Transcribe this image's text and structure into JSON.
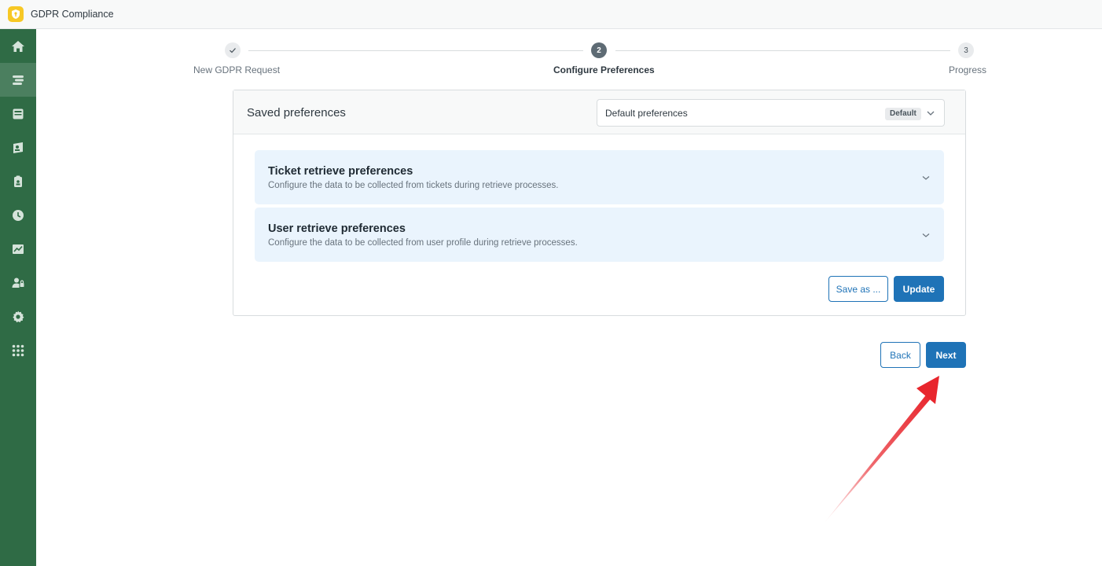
{
  "app": {
    "title": "GDPR Compliance",
    "logo_icon": "gdpr-shield-logo",
    "accent_color": "#1f73b7",
    "sidebar_color": "#2f6b45"
  },
  "sidebar": {
    "items": [
      {
        "icon": "home-icon",
        "active": false
      },
      {
        "icon": "requests-icon",
        "active": true
      },
      {
        "icon": "inbox-icon",
        "active": false
      },
      {
        "icon": "user-card-icon",
        "active": false
      },
      {
        "icon": "clipboard-user-icon",
        "active": false
      },
      {
        "icon": "clock-icon",
        "active": false
      },
      {
        "icon": "chart-icon",
        "active": false
      },
      {
        "icon": "user-lock-icon",
        "active": false
      },
      {
        "icon": "gear-icon",
        "active": false
      },
      {
        "icon": "apps-grid-icon",
        "active": false
      }
    ]
  },
  "stepper": {
    "steps": [
      {
        "number": "1",
        "label": "New GDPR Request",
        "state": "done"
      },
      {
        "number": "2",
        "label": "Configure Preferences",
        "state": "current"
      },
      {
        "number": "3",
        "label": "Progress",
        "state": "todo"
      }
    ]
  },
  "preferences": {
    "title": "Saved preferences",
    "select_value": "Default preferences",
    "select_badge": "Default",
    "sections": [
      {
        "title": "Ticket retrieve preferences",
        "description": "Configure the data to be collected from tickets during retrieve processes."
      },
      {
        "title": "User retrieve preferences",
        "description": "Configure the data to be collected from user profile during retrieve processes."
      }
    ],
    "save_as_label": "Save as ...",
    "update_label": "Update"
  },
  "footer": {
    "back_label": "Back",
    "next_label": "Next"
  },
  "annotation": {
    "arrow_color": "#e8262d",
    "arrow_target": "next-button"
  }
}
